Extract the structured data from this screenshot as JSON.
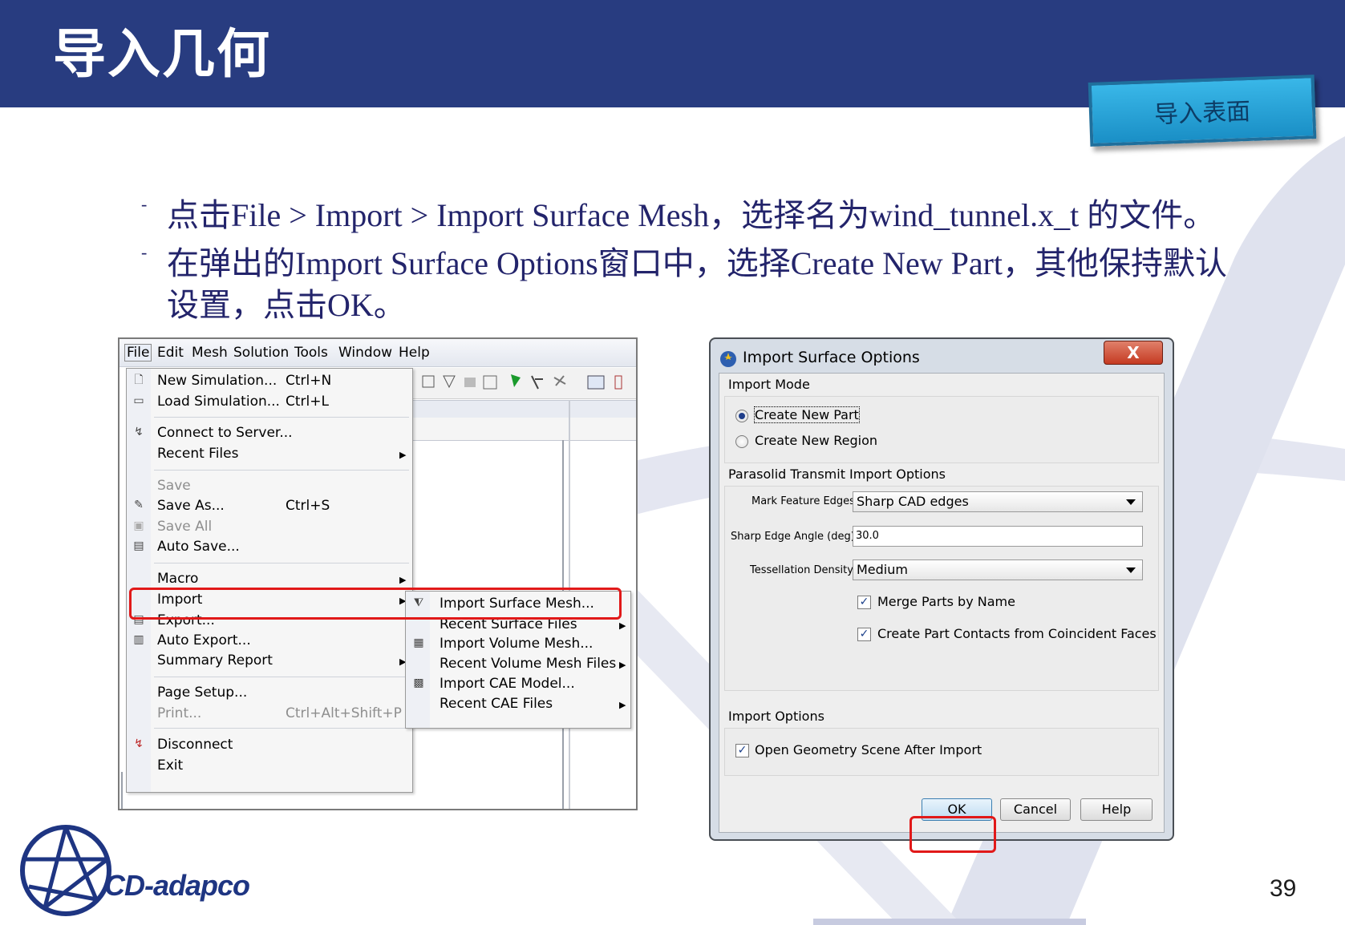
{
  "slide": {
    "title": "导入几何",
    "tag_button": "导入表面",
    "page_number": "39",
    "logo_text": "CD-adapco"
  },
  "bullets": [
    {
      "dash": "-",
      "text": "点击File > Import > Import Surface Mesh，选择名为wind_tunnel.x_t 的文件。"
    },
    {
      "dash": "-",
      "text": "在弹出的Import Surface Options窗口中，选择Create New Part，其他保持默认"
    },
    {
      "dash": "",
      "text": "设置，点击OK。"
    }
  ],
  "menubar": [
    "File",
    "Edit",
    "Mesh",
    "Solution",
    "Tools",
    "Window",
    "Help"
  ],
  "file_menu": {
    "new_simulation": {
      "label": "New Simulation...",
      "shortcut": "Ctrl+N"
    },
    "load_simulation": {
      "label": "Load Simulation...",
      "shortcut": "Ctrl+L"
    },
    "connect_server": {
      "label": "Connect to Server..."
    },
    "recent_files": {
      "label": "Recent Files"
    },
    "save": {
      "label": "Save"
    },
    "save_as": {
      "label": "Save As...",
      "shortcut": "Ctrl+S"
    },
    "save_all": {
      "label": "Save All"
    },
    "auto_save": {
      "label": "Auto Save..."
    },
    "macro": {
      "label": "Macro"
    },
    "import": {
      "label": "Import"
    },
    "export": {
      "label": "Export..."
    },
    "auto_export": {
      "label": "Auto Export..."
    },
    "summary_report": {
      "label": "Summary Report"
    },
    "page_setup": {
      "label": "Page Setup..."
    },
    "print": {
      "label": "Print...",
      "shortcut": "Ctrl+Alt+Shift+P"
    },
    "disconnect": {
      "label": "Disconnect"
    },
    "exit": {
      "label": "Exit"
    }
  },
  "import_submenu": {
    "import_surface_mesh": "Import Surface Mesh...",
    "recent_surface_files": "Recent Surface Files",
    "import_volume_mesh": "Import Volume Mesh...",
    "recent_volume_mesh_files": "Recent Volume Mesh Files",
    "import_cae_model": "Import CAE Model...",
    "recent_cae_files": "Recent CAE Files"
  },
  "dialog": {
    "title": "Import Surface Options",
    "close_label": "X",
    "import_mode": {
      "label": "Import Mode",
      "create_new_part": "Create New Part",
      "create_new_region": "Create New Region",
      "selected": "Create New Part"
    },
    "parasolid": {
      "label": "Parasolid Transmit Import Options",
      "mark_feature_edges_label": "Mark Feature Edges:",
      "mark_feature_edges_value": "Sharp CAD edges",
      "sharp_edge_angle_label": "Sharp Edge Angle (deg):",
      "sharp_edge_angle_value": "30.0",
      "tessellation_label": "Tessellation Density:",
      "tessellation_value": "Medium",
      "merge_parts_label": "Merge Parts by Name",
      "merge_parts_checked": true,
      "create_contacts_label": "Create Part Contacts from Coincident Faces",
      "create_contacts_checked": true
    },
    "import_options": {
      "label": "Import Options",
      "open_geometry_label": "Open Geometry Scene After Import",
      "open_geometry_checked": true
    },
    "buttons": {
      "ok": "OK",
      "cancel": "Cancel",
      "help": "Help"
    }
  },
  "colors": {
    "header": "#283c80",
    "highlight_red": "#e11919",
    "text_navy": "#23246b"
  }
}
